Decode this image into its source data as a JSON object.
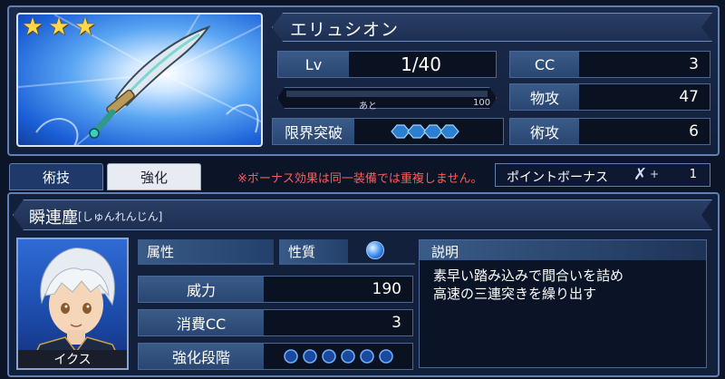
{
  "weapon": {
    "name": "エリュシオン",
    "rarity_stars": 3
  },
  "stats": {
    "lv_label": "Lv",
    "lv_value": "1/40",
    "exp_remaining_label": "あと",
    "exp_remaining_value": "100",
    "limit_break_label": "限界突破",
    "limit_break_gems": 4,
    "cc_label": "CC",
    "cc_value": "3",
    "phys_atk_label": "物攻",
    "phys_atk_value": "47",
    "arte_atk_label": "術攻",
    "arte_atk_value": "6"
  },
  "tabs": {
    "arte": "術技",
    "enhance": "強化"
  },
  "notice": "※ボーナス効果は同一装備では重複しません。",
  "bonus": {
    "label": "ポイントボーナス",
    "plus": "+",
    "value": "1"
  },
  "skill": {
    "name": "瞬連塵",
    "reading": "[しゅんれんじん]",
    "attribute_label": "属性",
    "property_label": "性質",
    "power_label": "威力",
    "power_value": "190",
    "cc_cost_label": "消費CC",
    "cc_cost_value": "3",
    "enhance_stage_label": "強化段階",
    "enhance_stage_slots": 6,
    "description_label": "説明",
    "description_line1": "素早い踏み込みで間合いを詰め",
    "description_line2": "高速の三連突きを繰り出す"
  },
  "character": {
    "name": "イクス"
  },
  "colors": {
    "accent": "#5f7fb5",
    "notice": "#ff5a5a",
    "star": "#ffd84a"
  }
}
